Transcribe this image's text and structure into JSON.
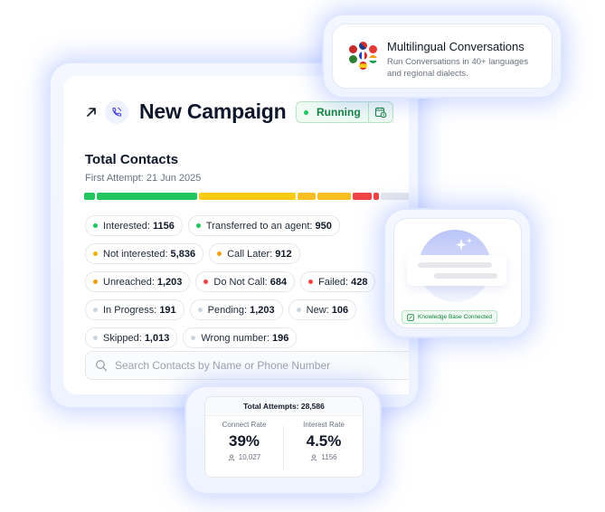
{
  "campaign": {
    "title": "New Campaign",
    "status_label": "Running"
  },
  "contacts": {
    "heading": "Total Contacts",
    "first_attempt": "First Attempt: 21 Jun 2025",
    "chips": [
      {
        "label": "Interested:",
        "value": "1156",
        "color": "#22c55e"
      },
      {
        "label": "Transferred to an agent:",
        "value": "950",
        "color": "#22c55e"
      },
      {
        "label": "Not interested:",
        "value": "5,836",
        "color": "#eab308"
      },
      {
        "label": "Call Later:",
        "value": "912",
        "color": "#f59e0b"
      },
      {
        "label": "Unreached:",
        "value": "1,203",
        "color": "#f59e0b"
      },
      {
        "label": "Do Not Call:",
        "value": "684",
        "color": "#ef4444"
      },
      {
        "label": "Failed:",
        "value": "428",
        "color": "#ef4444"
      },
      {
        "label": "In Progress:",
        "value": "191",
        "color": "#cbd5e1"
      },
      {
        "label": "Pending:",
        "value": "1,203",
        "color": "#cbd5e1"
      },
      {
        "label": "New:",
        "value": "106",
        "color": "#cbd5e1"
      },
      {
        "label": "Skipped:",
        "value": "1,013",
        "color": "#cbd5e1"
      },
      {
        "label": "Wrong number:",
        "value": "196",
        "color": "#cbd5e1"
      }
    ],
    "bar_segments": [
      {
        "color": "#22c55e",
        "share": 0.03
      },
      {
        "color": "#22c55e",
        "share": 0.27
      },
      {
        "color": "#facc15",
        "share": 0.26
      },
      {
        "color": "#fbbf24",
        "share": 0.05
      },
      {
        "color": "#fbbf24",
        "share": 0.09
      },
      {
        "color": "#ef4444",
        "share": 0.05
      },
      {
        "color": "#ef4444",
        "share": 0.015
      },
      {
        "color": "#e5e7eb",
        "share": 0.1
      },
      {
        "color": "#e5e7eb",
        "share": 0.12
      }
    ],
    "search_placeholder": "Search Contacts by Name or Phone Number"
  },
  "multilingual": {
    "title": "Multilingual Conversations",
    "description": "Run Conversations in 40+ languages and regional dialects."
  },
  "knowledge_base": {
    "badge": "Knowledge Base Connected"
  },
  "attempts": {
    "total": "Total Attempts: 28,586",
    "connect_label": "Connect Rate",
    "connect_value": "39%",
    "connect_count": "10,027",
    "interest_label": "Interest Rate",
    "interest_value": "4.5%",
    "interest_count": "1156"
  },
  "colors": {
    "accent": "#6a86ff",
    "success": "#15803d"
  }
}
